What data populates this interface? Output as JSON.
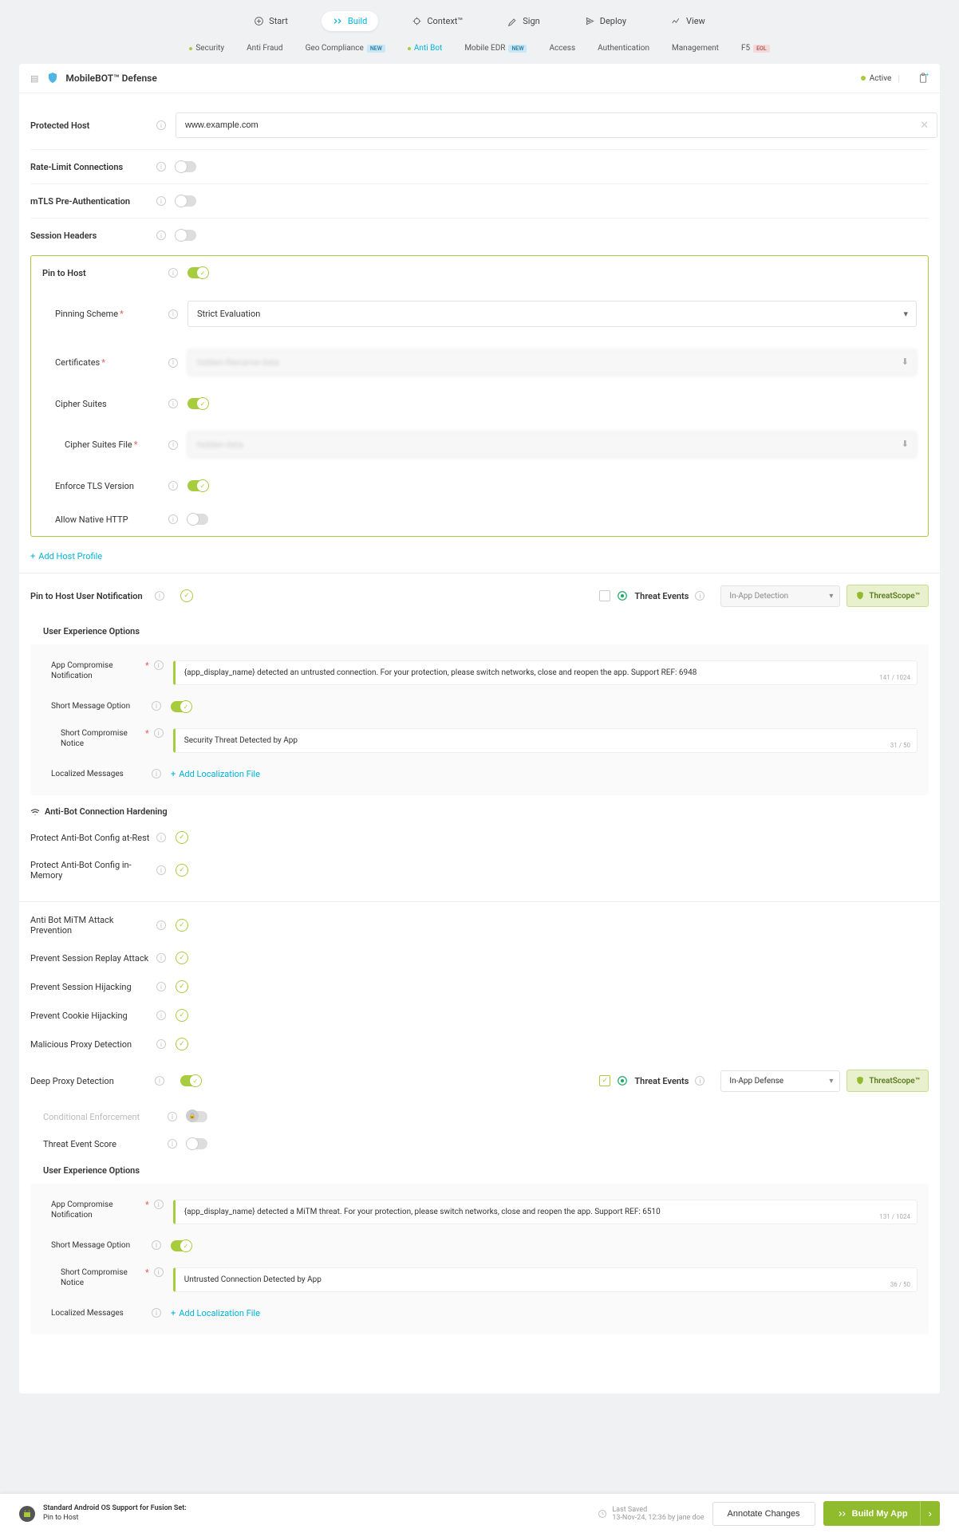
{
  "topnav": [
    {
      "label": "Start",
      "active": false
    },
    {
      "label": "Build",
      "active": true
    },
    {
      "label": "Context™",
      "active": false
    },
    {
      "label": "Sign",
      "active": false
    },
    {
      "label": "Deploy",
      "active": false
    },
    {
      "label": "View",
      "active": false
    }
  ],
  "subnav": [
    {
      "label": "Security",
      "dot": true
    },
    {
      "label": "Anti Fraud"
    },
    {
      "label": "Geo Compliance",
      "badge": "NEW"
    },
    {
      "label": "Anti Bot",
      "dot": true,
      "active": true
    },
    {
      "label": "Mobile EDR",
      "badge": "NEW"
    },
    {
      "label": "Access"
    },
    {
      "label": "Authentication"
    },
    {
      "label": "Management"
    },
    {
      "label": "F5",
      "badge": "EOL"
    }
  ],
  "page": {
    "title": "MobileBOT™ Defense",
    "status": "Active"
  },
  "fields": {
    "protected_host": {
      "label": "Protected Host",
      "value": "www.example.com"
    },
    "rate_limit": {
      "label": "Rate-Limit Connections"
    },
    "mtls": {
      "label": "mTLS Pre-Authentication"
    },
    "session_headers": {
      "label": "Session Headers"
    },
    "pin_to_host": {
      "label": "Pin to Host"
    },
    "pinning_scheme": {
      "label": "Pinning Scheme",
      "value": "Strict Evaluation"
    },
    "certificates": {
      "label": "Certificates",
      "value": "file-hidden"
    },
    "cipher_suites": {
      "label": "Cipher Suites"
    },
    "cipher_file": {
      "label": "Cipher Suites File",
      "value": "file-data"
    },
    "enforce_tls": {
      "label": "Enforce TLS Version"
    },
    "allow_http": {
      "label": "Allow Native HTTP"
    },
    "add_host": "Add Host Profile"
  },
  "notify1": {
    "title": "Pin to Host User Notification",
    "threat_events": "Threat Events",
    "mode": "In-App Detection",
    "ts": "ThreatScope™",
    "ux_title": "User Experience Options",
    "app_notif_label": "App Compromise Notification",
    "app_notif_msg": "{app_display_name} detected an untrusted connection. For your protection, please switch networks, close and reopen the app. Support REF: 6948",
    "app_notif_count": "141 / 1024",
    "short_opt": "Short Message Option",
    "short_notice_label": "Short Compromise Notice",
    "short_notice_msg": "Security Threat Detected by App",
    "short_notice_count": "31 / 50",
    "localized": "Localized Messages",
    "add_loc": "Add Localization File"
  },
  "antibot": {
    "title": "Anti-Bot Connection Hardening",
    "items": [
      "Protect Anti-Bot Config at-Rest",
      "Protect Anti-Bot Config in-Memory"
    ]
  },
  "checklist": [
    "Anti Bot MiTM Attack Prevention",
    "Prevent Session Replay Attack",
    "Prevent Session Hijacking",
    "Prevent Cookie Hijacking",
    "Malicious Proxy Detection"
  ],
  "deep_proxy": {
    "label": "Deep Proxy Detection",
    "threat_events": "Threat Events",
    "mode": "In-App Defense",
    "ts": "ThreatScope™",
    "cond_enf": "Conditional Enforcement",
    "threat_score": "Threat Event Score",
    "ux_title": "User Experience Options",
    "app_notif_label": "App Compromise Notification",
    "app_notif_msg": "{app_display_name} detected a MiTM threat. For your protection, please switch networks, close and reopen the app. Support REF: 6510",
    "app_notif_count": "131 / 1024",
    "short_opt": "Short Message Option",
    "short_notice_label": "Short Compromise Notice",
    "short_notice_msg": "Untrusted Connection Detected by App",
    "short_notice_count": "36 / 50",
    "localized": "Localized Messages",
    "add_loc": "Add Localization File"
  },
  "footer": {
    "fs_title": "Standard Android OS Support for Fusion Set:",
    "fs_sub": "Pin to Host",
    "saved_label": "Last Saved",
    "saved_time": "13-Nov-24, 12:36 by jane doe",
    "annotate": "Annotate Changes",
    "build": "Build My App"
  }
}
